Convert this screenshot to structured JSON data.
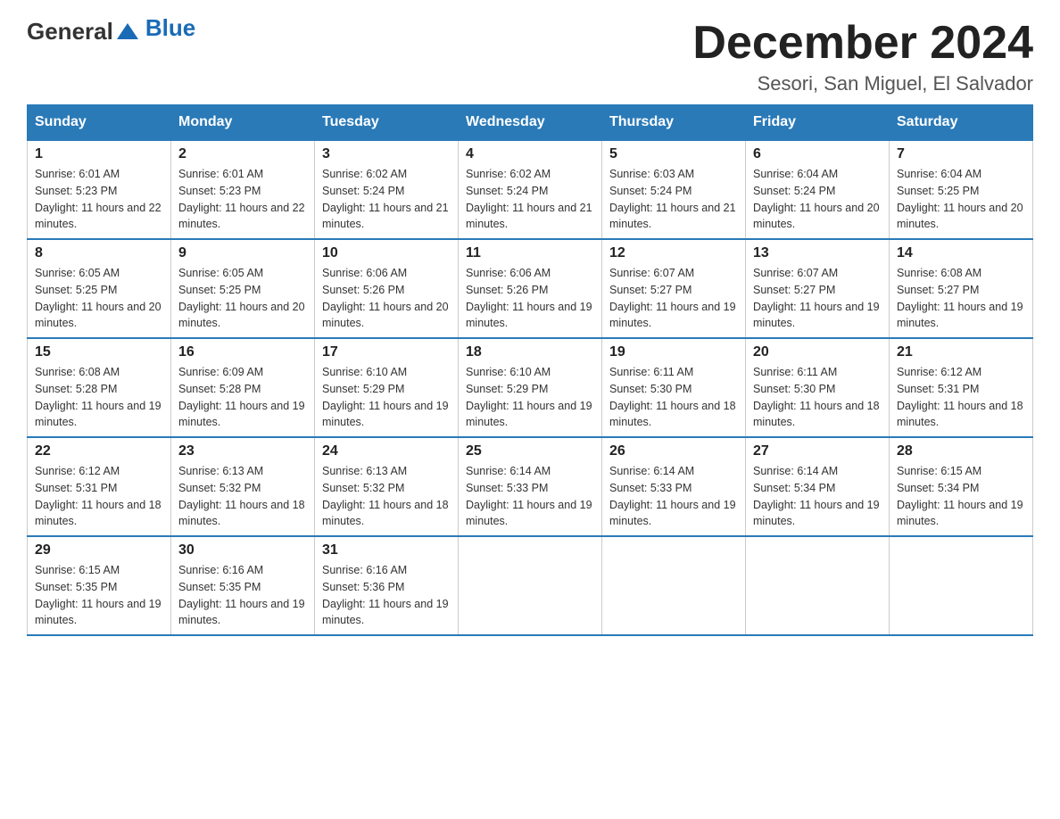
{
  "header": {
    "logo_general": "General",
    "logo_blue": "Blue",
    "month_title": "December 2024",
    "subtitle": "Sesori, San Miguel, El Salvador"
  },
  "days_of_week": [
    "Sunday",
    "Monday",
    "Tuesday",
    "Wednesday",
    "Thursday",
    "Friday",
    "Saturday"
  ],
  "weeks": [
    [
      {
        "day": "1",
        "sunrise": "6:01 AM",
        "sunset": "5:23 PM",
        "daylight": "11 hours and 22 minutes."
      },
      {
        "day": "2",
        "sunrise": "6:01 AM",
        "sunset": "5:23 PM",
        "daylight": "11 hours and 22 minutes."
      },
      {
        "day": "3",
        "sunrise": "6:02 AM",
        "sunset": "5:24 PM",
        "daylight": "11 hours and 21 minutes."
      },
      {
        "day": "4",
        "sunrise": "6:02 AM",
        "sunset": "5:24 PM",
        "daylight": "11 hours and 21 minutes."
      },
      {
        "day": "5",
        "sunrise": "6:03 AM",
        "sunset": "5:24 PM",
        "daylight": "11 hours and 21 minutes."
      },
      {
        "day": "6",
        "sunrise": "6:04 AM",
        "sunset": "5:24 PM",
        "daylight": "11 hours and 20 minutes."
      },
      {
        "day": "7",
        "sunrise": "6:04 AM",
        "sunset": "5:25 PM",
        "daylight": "11 hours and 20 minutes."
      }
    ],
    [
      {
        "day": "8",
        "sunrise": "6:05 AM",
        "sunset": "5:25 PM",
        "daylight": "11 hours and 20 minutes."
      },
      {
        "day": "9",
        "sunrise": "6:05 AM",
        "sunset": "5:25 PM",
        "daylight": "11 hours and 20 minutes."
      },
      {
        "day": "10",
        "sunrise": "6:06 AM",
        "sunset": "5:26 PM",
        "daylight": "11 hours and 20 minutes."
      },
      {
        "day": "11",
        "sunrise": "6:06 AM",
        "sunset": "5:26 PM",
        "daylight": "11 hours and 19 minutes."
      },
      {
        "day": "12",
        "sunrise": "6:07 AM",
        "sunset": "5:27 PM",
        "daylight": "11 hours and 19 minutes."
      },
      {
        "day": "13",
        "sunrise": "6:07 AM",
        "sunset": "5:27 PM",
        "daylight": "11 hours and 19 minutes."
      },
      {
        "day": "14",
        "sunrise": "6:08 AM",
        "sunset": "5:27 PM",
        "daylight": "11 hours and 19 minutes."
      }
    ],
    [
      {
        "day": "15",
        "sunrise": "6:08 AM",
        "sunset": "5:28 PM",
        "daylight": "11 hours and 19 minutes."
      },
      {
        "day": "16",
        "sunrise": "6:09 AM",
        "sunset": "5:28 PM",
        "daylight": "11 hours and 19 minutes."
      },
      {
        "day": "17",
        "sunrise": "6:10 AM",
        "sunset": "5:29 PM",
        "daylight": "11 hours and 19 minutes."
      },
      {
        "day": "18",
        "sunrise": "6:10 AM",
        "sunset": "5:29 PM",
        "daylight": "11 hours and 19 minutes."
      },
      {
        "day": "19",
        "sunrise": "6:11 AM",
        "sunset": "5:30 PM",
        "daylight": "11 hours and 18 minutes."
      },
      {
        "day": "20",
        "sunrise": "6:11 AM",
        "sunset": "5:30 PM",
        "daylight": "11 hours and 18 minutes."
      },
      {
        "day": "21",
        "sunrise": "6:12 AM",
        "sunset": "5:31 PM",
        "daylight": "11 hours and 18 minutes."
      }
    ],
    [
      {
        "day": "22",
        "sunrise": "6:12 AM",
        "sunset": "5:31 PM",
        "daylight": "11 hours and 18 minutes."
      },
      {
        "day": "23",
        "sunrise": "6:13 AM",
        "sunset": "5:32 PM",
        "daylight": "11 hours and 18 minutes."
      },
      {
        "day": "24",
        "sunrise": "6:13 AM",
        "sunset": "5:32 PM",
        "daylight": "11 hours and 18 minutes."
      },
      {
        "day": "25",
        "sunrise": "6:14 AM",
        "sunset": "5:33 PM",
        "daylight": "11 hours and 19 minutes."
      },
      {
        "day": "26",
        "sunrise": "6:14 AM",
        "sunset": "5:33 PM",
        "daylight": "11 hours and 19 minutes."
      },
      {
        "day": "27",
        "sunrise": "6:14 AM",
        "sunset": "5:34 PM",
        "daylight": "11 hours and 19 minutes."
      },
      {
        "day": "28",
        "sunrise": "6:15 AM",
        "sunset": "5:34 PM",
        "daylight": "11 hours and 19 minutes."
      }
    ],
    [
      {
        "day": "29",
        "sunrise": "6:15 AM",
        "sunset": "5:35 PM",
        "daylight": "11 hours and 19 minutes."
      },
      {
        "day": "30",
        "sunrise": "6:16 AM",
        "sunset": "5:35 PM",
        "daylight": "11 hours and 19 minutes."
      },
      {
        "day": "31",
        "sunrise": "6:16 AM",
        "sunset": "5:36 PM",
        "daylight": "11 hours and 19 minutes."
      },
      null,
      null,
      null,
      null
    ]
  ]
}
